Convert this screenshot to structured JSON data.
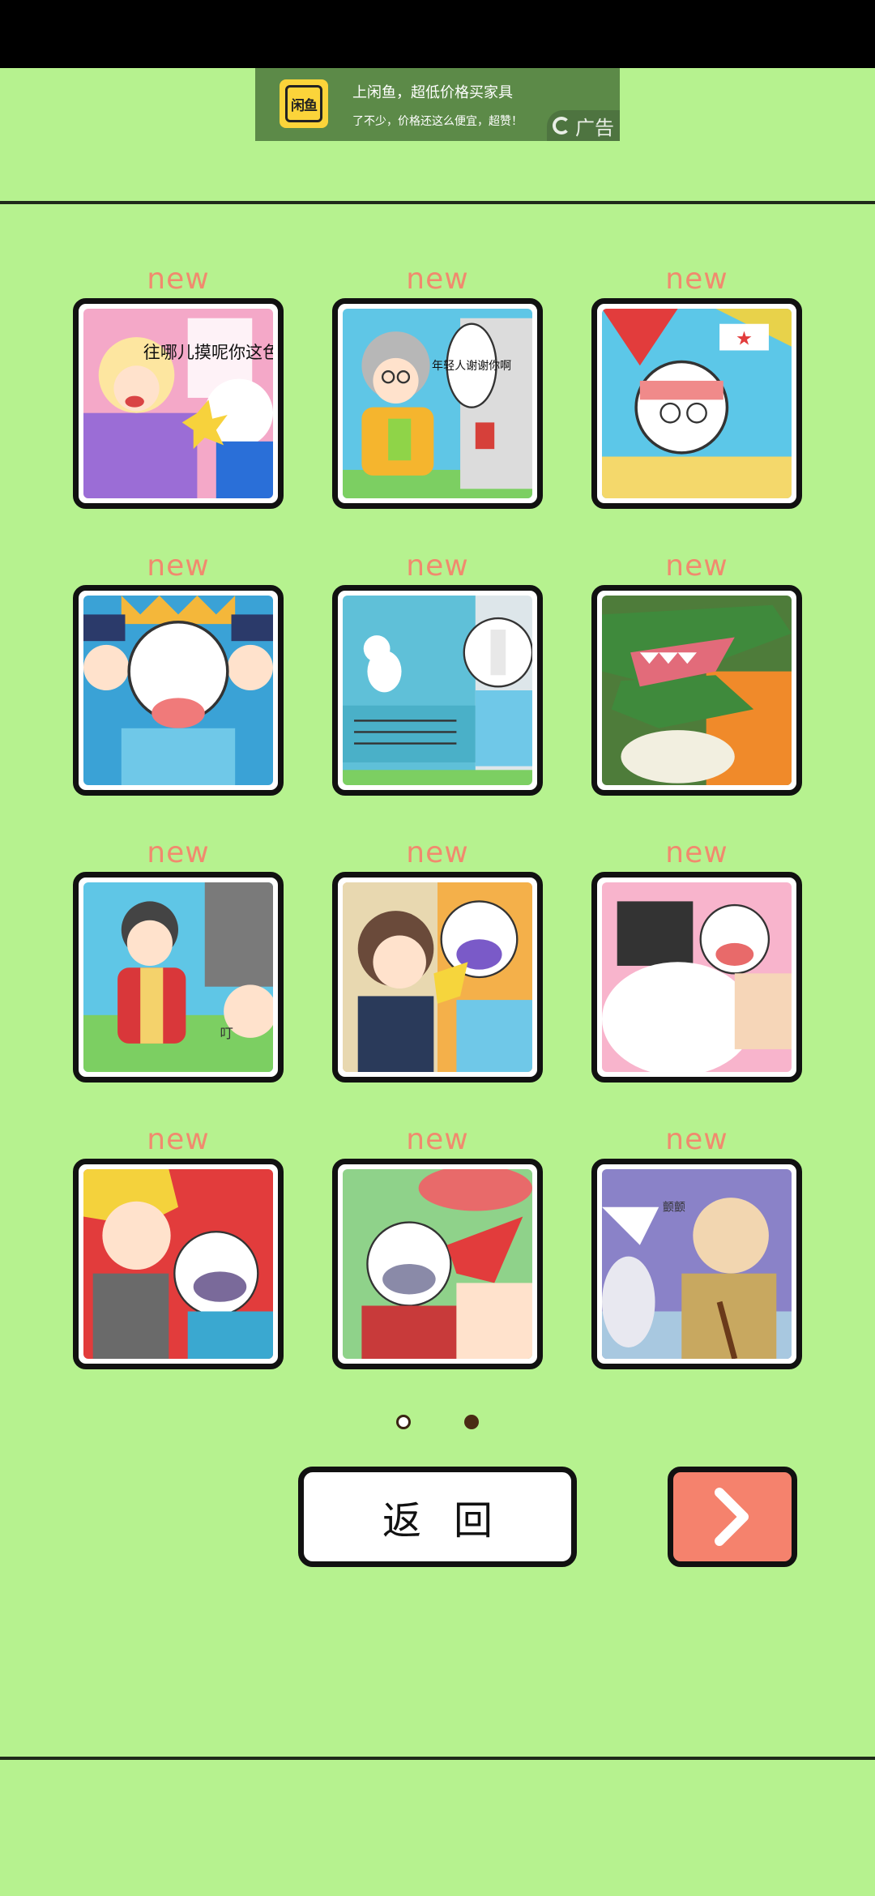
{
  "ad": {
    "logo_text": "闲鱼",
    "title": "上闲鱼，超低价格买家具",
    "description": "了不少，价格还这么便宜，超赞！",
    "tag": "广告"
  },
  "levels": [
    {
      "label": "new",
      "art": "blonde-woman-slap-comic",
      "caption": "往哪儿摸呢你这色狼"
    },
    {
      "label": "new",
      "art": "grandma-thanks-comic",
      "caption": "年轻人谢谢你啊"
    },
    {
      "label": "new",
      "art": "dizzy-helmet-hero-comic",
      "caption": ""
    },
    {
      "label": "new",
      "art": "police-crying-hero-comic",
      "caption": ""
    },
    {
      "label": "new",
      "art": "cat-on-car-comic",
      "caption": ""
    },
    {
      "label": "new",
      "art": "crocodile-attack-comic",
      "caption": ""
    },
    {
      "label": "new",
      "art": "kimono-girl-comic",
      "caption": "叮"
    },
    {
      "label": "new",
      "art": "office-lady-slap-comic",
      "caption": ""
    },
    {
      "label": "new",
      "art": "hug-scene-comic",
      "caption": ""
    },
    {
      "label": "new",
      "art": "blonde-thug-comic",
      "caption": ""
    },
    {
      "label": "new",
      "art": "crying-hero-comic",
      "caption": ""
    },
    {
      "label": "new",
      "art": "old-man-cane-comic",
      "caption": "颤颤"
    }
  ],
  "pagination": {
    "total": 2,
    "current": 2
  },
  "buttons": {
    "back_label": "返回",
    "next_icon": "chevron-right-icon"
  },
  "colors": {
    "background": "#b6f28f",
    "new_label": "#f18a6e",
    "next_button": "#f5826d",
    "ad_background": "#5c8a48"
  }
}
